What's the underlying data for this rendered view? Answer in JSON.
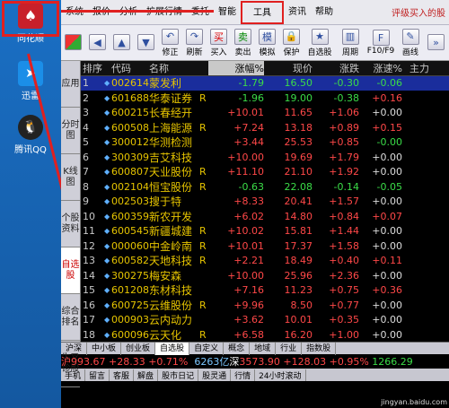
{
  "desktop": {
    "icons": [
      {
        "label": "同花顺"
      },
      {
        "label": "迅雷"
      },
      {
        "label": "腾讯QQ"
      }
    ]
  },
  "menu": {
    "items": [
      "系统",
      "报价",
      "分析",
      "扩展行情",
      "委托",
      "智能",
      "工具",
      "资讯",
      "帮助"
    ],
    "promo": "评级买入的股"
  },
  "toolbar": {
    "buttons": [
      {
        "icon": "grid",
        "label": ""
      },
      {
        "icon": "back",
        "label": ""
      },
      {
        "icon": "up",
        "label": ""
      },
      {
        "icon": "down",
        "label": ""
      },
      {
        "icon": "undo",
        "label": "修正"
      },
      {
        "icon": "redo",
        "label": "刷新"
      },
      {
        "icon": "buy",
        "label": "买入"
      },
      {
        "icon": "sell",
        "label": "卖出"
      },
      {
        "icon": "sim",
        "label": "模拟"
      },
      {
        "icon": "lock",
        "label": "保护"
      },
      {
        "icon": "self",
        "label": "自选股"
      },
      {
        "icon": "cycle",
        "label": "周期"
      },
      {
        "icon": "f10",
        "label": "F10/F9"
      },
      {
        "icon": "draw",
        "label": "画线"
      },
      {
        "icon": "more",
        "label": ""
      }
    ]
  },
  "side": {
    "tabs": [
      "应用",
      "分时图",
      "K线图",
      "个股资料",
      "自选股",
      "综合排名",
      "牛叉诊股"
    ],
    "active": 4
  },
  "table": {
    "headers": [
      "排序",
      "",
      "代码",
      "名称",
      "",
      "涨幅%",
      "现价",
      "涨跌",
      "涨速%",
      "主力"
    ],
    "rows": [
      {
        "n": "1",
        "code": "002614",
        "name": "蒙发利",
        "r": "",
        "pct": "-1.79",
        "price": "16.50",
        "chg": "-0.30",
        "spd": "-0.06",
        "dir": "dn",
        "spddir": "dn"
      },
      {
        "n": "2",
        "code": "601688",
        "name": "华泰证券",
        "r": "R",
        "pct": "-1.96",
        "price": "19.00",
        "chg": "-0.38",
        "spd": "+0.16",
        "dir": "dn",
        "spddir": "up"
      },
      {
        "n": "3",
        "code": "600215",
        "name": "长春经开",
        "r": "",
        "pct": "+10.01",
        "price": "11.65",
        "chg": "+1.06",
        "spd": "+0.00",
        "dir": "up",
        "spddir": "w"
      },
      {
        "n": "4",
        "code": "600508",
        "name": "上海能源",
        "r": "R",
        "pct": "+7.24",
        "price": "13.18",
        "chg": "+0.89",
        "spd": "+0.15",
        "dir": "up",
        "spddir": "up"
      },
      {
        "n": "5",
        "code": "300012",
        "name": "华测检测",
        "r": "",
        "pct": "+3.44",
        "price": "25.53",
        "chg": "+0.85",
        "spd": "-0.00",
        "dir": "up",
        "spddir": "dn"
      },
      {
        "n": "6",
        "code": "300309",
        "name": "吉艾科技",
        "r": "",
        "pct": "+10.00",
        "price": "19.69",
        "chg": "+1.79",
        "spd": "+0.00",
        "dir": "up",
        "spddir": "w"
      },
      {
        "n": "7",
        "code": "600807",
        "name": "天业股份",
        "r": "R",
        "pct": "+11.10",
        "price": "21.10",
        "chg": "+1.92",
        "spd": "+0.00",
        "dir": "up",
        "spddir": "w"
      },
      {
        "n": "8",
        "code": "002104",
        "name": "恒宝股份",
        "r": "R",
        "pct": "-0.63",
        "price": "22.08",
        "chg": "-0.14",
        "spd": "-0.05",
        "dir": "dn",
        "spddir": "dn"
      },
      {
        "n": "9",
        "code": "002503",
        "name": "搜于特",
        "r": "",
        "pct": "+8.33",
        "price": "20.41",
        "chg": "+1.57",
        "spd": "+0.00",
        "dir": "up",
        "spddir": "w"
      },
      {
        "n": "10",
        "code": "600359",
        "name": "新农开发",
        "r": "",
        "pct": "+6.02",
        "price": "14.80",
        "chg": "+0.84",
        "spd": "+0.07",
        "dir": "up",
        "spddir": "up"
      },
      {
        "n": "11",
        "code": "600545",
        "name": "新疆城建",
        "r": "R",
        "pct": "+10.02",
        "price": "15.81",
        "chg": "+1.44",
        "spd": "+0.00",
        "dir": "up",
        "spddir": "w"
      },
      {
        "n": "12",
        "code": "000060",
        "name": "中金岭南",
        "r": "R",
        "pct": "+10.01",
        "price": "17.37",
        "chg": "+1.58",
        "spd": "+0.00",
        "dir": "up",
        "spddir": "w"
      },
      {
        "n": "13",
        "code": "600582",
        "name": "天地科技",
        "r": "R",
        "pct": "+2.21",
        "price": "18.49",
        "chg": "+0.40",
        "spd": "+0.11",
        "dir": "up",
        "spddir": "up"
      },
      {
        "n": "14",
        "code": "300275",
        "name": "梅安森",
        "r": "",
        "pct": "+10.00",
        "price": "25.96",
        "chg": "+2.36",
        "spd": "+0.00",
        "dir": "up",
        "spddir": "w"
      },
      {
        "n": "15",
        "code": "601208",
        "name": "东材科技",
        "r": "",
        "pct": "+7.16",
        "price": "11.23",
        "chg": "+0.75",
        "spd": "+0.36",
        "dir": "up",
        "spddir": "up"
      },
      {
        "n": "16",
        "code": "600725",
        "name": "云维股份",
        "r": "R",
        "pct": "+9.96",
        "price": "8.50",
        "chg": "+0.77",
        "spd": "+0.00",
        "dir": "up",
        "spddir": "w"
      },
      {
        "n": "17",
        "code": "000903",
        "name": "云内动力",
        "r": "",
        "pct": "+3.62",
        "price": "10.01",
        "chg": "+0.35",
        "spd": "+0.00",
        "dir": "up",
        "spddir": "w"
      },
      {
        "n": "18",
        "code": "600096",
        "name": "云天化",
        "r": "R",
        "pct": "+6.58",
        "price": "16.20",
        "chg": "+1.00",
        "spd": "+0.00",
        "dir": "up",
        "spddir": "w"
      }
    ]
  },
  "bottomtabs": {
    "items": [
      "沪深",
      "中小板",
      "创业板",
      "自选股",
      "自定义",
      "概念",
      "地域",
      "行业",
      "指数股"
    ],
    "active": 3
  },
  "index": {
    "sh_label": "沪",
    "sh": "993.67",
    "sh_chg": "+28.33",
    "sh_pct": "+0.71%",
    "sh_amt": "6263亿",
    "sz_label": "深",
    "sz": "3573.90",
    "sz_chg": "+128.03",
    "sz_pct": "+0.95%",
    "tail": "1266.29"
  },
  "status": {
    "items": [
      "手机",
      "留言",
      "客服",
      "解盘",
      "股市日记",
      "股灵通",
      "行情",
      "24小时滚动"
    ]
  },
  "watermark": "jingyan.baidu.com"
}
